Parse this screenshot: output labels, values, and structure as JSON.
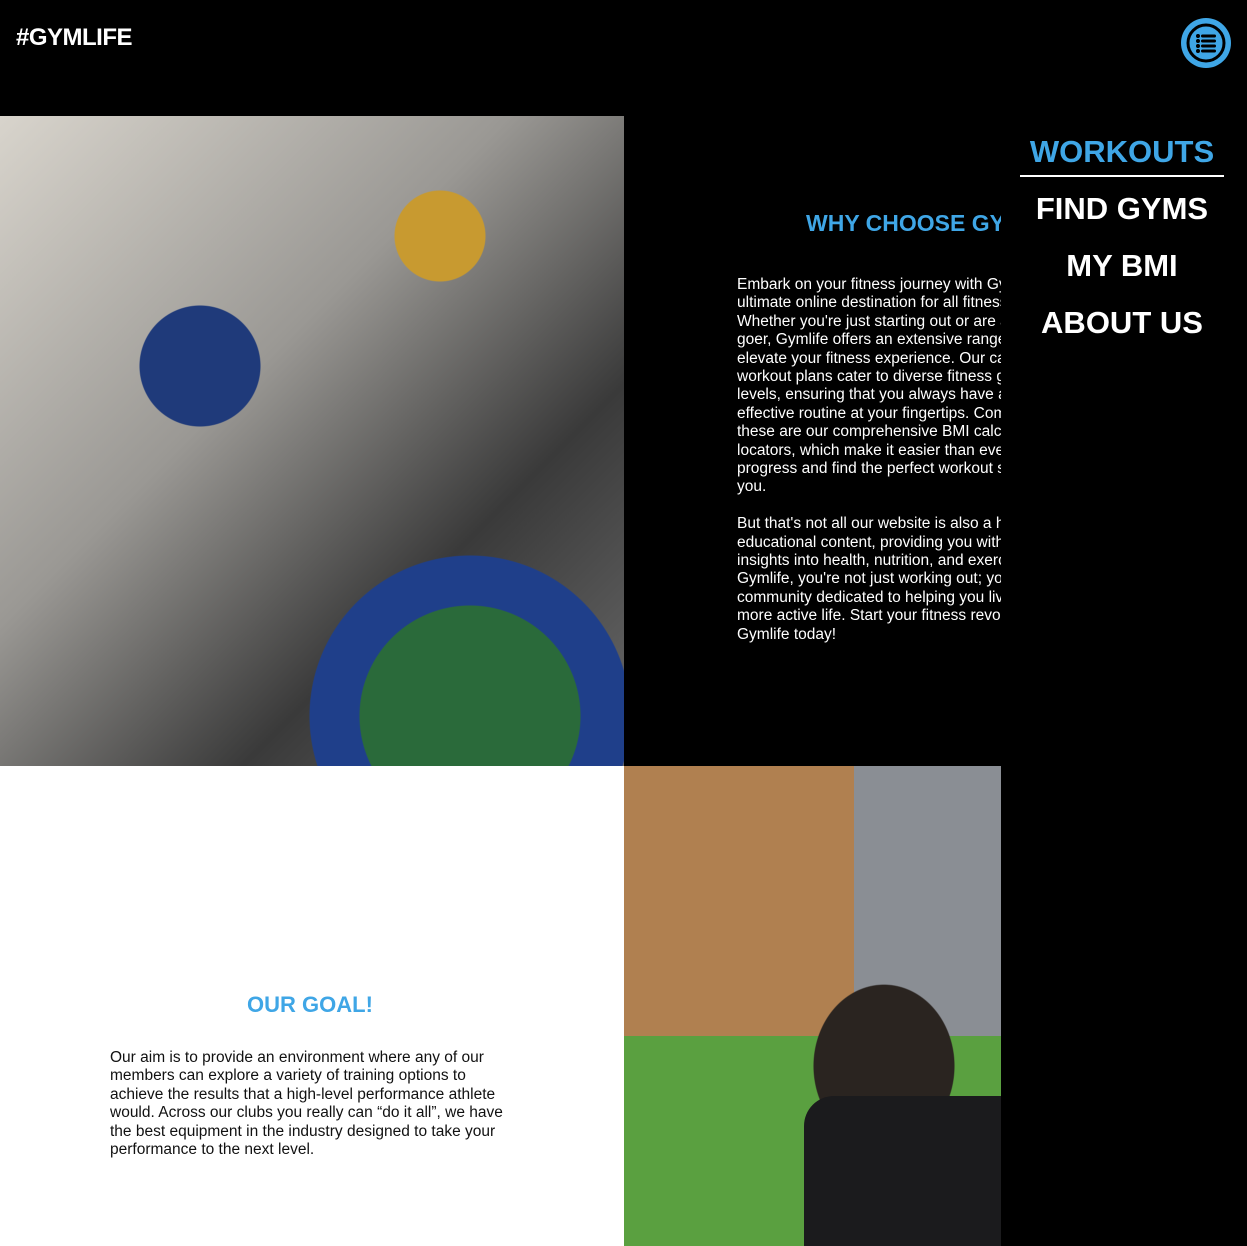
{
  "header": {
    "logo": "#GYMLIFE",
    "menu_icon": "list-icon"
  },
  "nav": {
    "items": [
      {
        "label": "WORKOUTS",
        "active": true
      },
      {
        "label": "FIND GYMS"
      },
      {
        "label": "MY BMI"
      },
      {
        "label": "ABOUT US"
      }
    ]
  },
  "why": {
    "title": "WHY CHOOSE GYMLIFE?",
    "p1": [
      "Embark on your fitness journey with Gymlife, your",
      "ultimate online destination for all fitness needs.",
      "Whether you're just starting out or are a seasoned gym",
      "goer, Gymlife offers an extensive range of resources to",
      "elevate your fitness experience. Our carefully curated",
      "workout plans cater to diverse fitness goals and",
      "levels, ensuring that you always have an",
      "effective routine at your fingertips. Complementing",
      "these are our comprehensive BMI calculators and gym",
      "locators, which make it easier than ever to track your",
      "progress and find the perfect workout spot near",
      "you."
    ],
    "p2": [
      "But that's not all our website is also a hub of",
      "educational content, providing you with valuable",
      "insights into health, nutrition, and exercise. With",
      "Gymlife, you're not just working out; you're joining a",
      "community dedicated to helping you live a healthier,",
      "more active life. Start your fitness revolution with",
      "Gymlife today!"
    ]
  },
  "goal": {
    "title": "OUR GOAL!",
    "text": "Our aim is to provide an environment where any of our members can explore a variety of training options to achieve the results that a high-level performance athlete would. Across our clubs you really can “do it all”, we have the best equipment in the industry designed to take your performance to the next level."
  },
  "colors": {
    "accent": "#3fa6e6"
  }
}
